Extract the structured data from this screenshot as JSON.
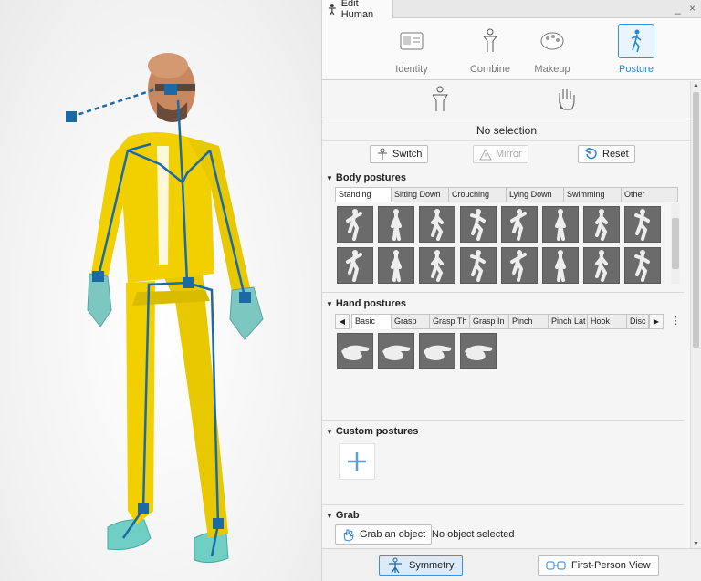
{
  "window": {
    "title": "Edit Human",
    "controls": "_ ×"
  },
  "modes": [
    {
      "label": "Identity",
      "icon": "id-card-icon"
    },
    {
      "label": "Combine",
      "icon": "figure-icon"
    },
    {
      "label": "Makeup",
      "icon": "palette-icon"
    },
    {
      "label": "Posture",
      "icon": "posture-icon",
      "active": true
    }
  ],
  "selection": {
    "status": "No selection"
  },
  "actions": {
    "switch_label": "Switch",
    "mirror_label": "Mirror",
    "reset_label": "Reset"
  },
  "body_postures": {
    "header": "Body postures",
    "tabs": [
      "Standing",
      "Sitting Down",
      "Crouching",
      "Lying Down",
      "Swimming",
      "Other"
    ],
    "active_tab": "Standing"
  },
  "hand_postures": {
    "header": "Hand postures",
    "tabs": [
      "Basic",
      "Grasp",
      "Grasp Th",
      "Grasp In",
      "Pinch",
      "Pinch Lat",
      "Hook",
      "Disc"
    ],
    "active_tab": "Basic"
  },
  "custom_postures": {
    "header": "Custom postures"
  },
  "grab": {
    "header": "Grab",
    "button_label": "Grab an object",
    "status": "No object selected"
  },
  "bottom": {
    "symmetry_label": "Symmetry",
    "first_person_label": "First-Person View"
  },
  "colors": {
    "accent": "#2a86d4",
    "suit": "#f2d000",
    "skeleton": "#1b6aa5",
    "gloves": "#7cc8c0"
  }
}
